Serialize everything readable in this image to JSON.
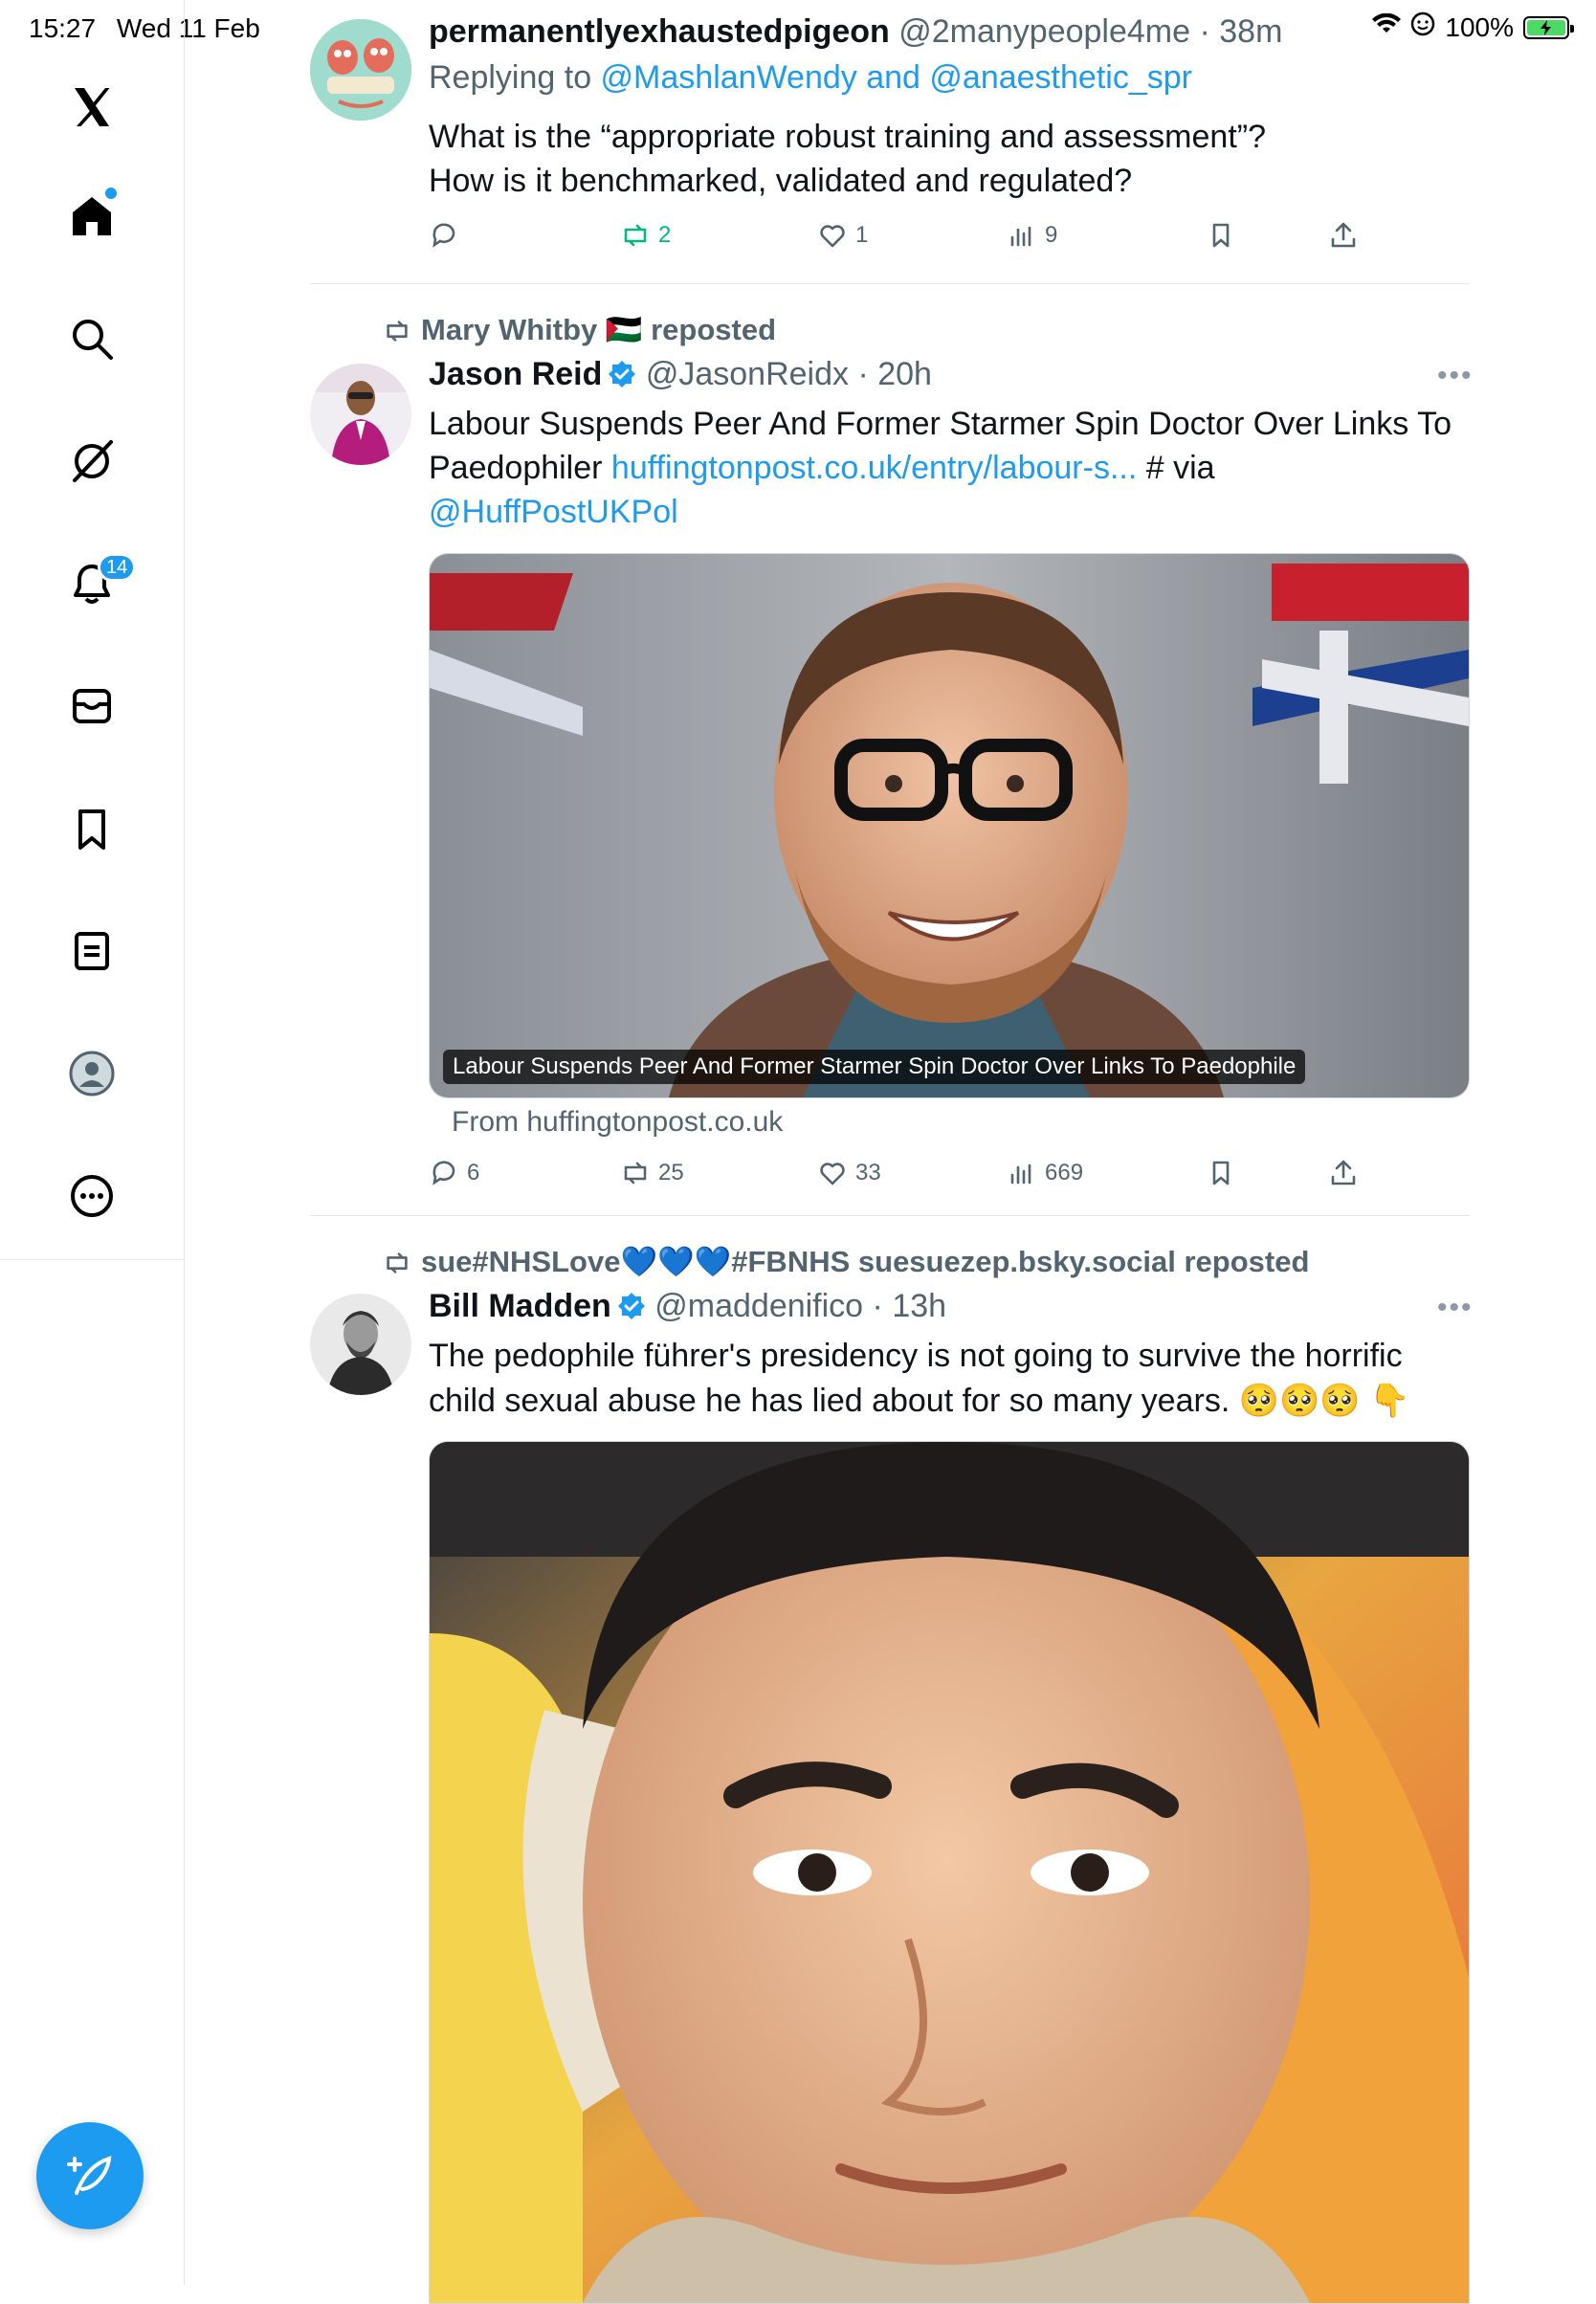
{
  "status": {
    "time": "15:27",
    "date": "Wed 11 Feb",
    "battery": "100%"
  },
  "nav": {
    "notifications_badge": "14"
  },
  "tweet1": {
    "display_name": "permanentlyexhaustedpigeon",
    "handle": "@2manypeople4me",
    "time": "38m",
    "reply_prefix": "Replying to ",
    "reply_to": "@MashlanWendy and @anaesthetic_spr",
    "text_line1": "What is the “appropriate robust training and assessment”?",
    "text_line2": "How is it benchmarked, validated and regulated?",
    "reposts": "2",
    "likes": "1",
    "views": "9"
  },
  "tweet2": {
    "reposted_by": "Mary Whitby 🇵🇸 reposted",
    "display_name": "Jason Reid",
    "handle": "@JasonReidx",
    "time": "20h",
    "text_line1": "Labour Suspends Peer And Former Starmer Spin Doctor Over Links To",
    "text_line2_a": "Paedophiler ",
    "text_line2_link": "huffingtonpost.co.uk/entry/labour-s...",
    "text_line2_b": " # via",
    "text_line3": "@HuffPostUKPol",
    "card_caption": "Labour Suspends Peer And Former Starmer Spin Doctor Over Links To Paedophile",
    "card_source": "From huffingtonpost.co.uk",
    "replies": "6",
    "reposts": "25",
    "likes": "33",
    "views": "669"
  },
  "tweet3": {
    "reposted_by": "sue#NHSLove💙💙💙#FBNHS suesuezep.bsky.social reposted",
    "display_name": "Bill Madden",
    "handle": "@maddenifico",
    "time": "13h",
    "text_line1": "The pedophile führer's presidency is not going to survive the horrific",
    "text_line2": "child sexual abuse he has lied about for so many years. 🥺🥺🥺 👇"
  },
  "colors": {
    "accent": "#1d9bf0",
    "repost_green": "#00ba7c",
    "muted": "#536471"
  }
}
